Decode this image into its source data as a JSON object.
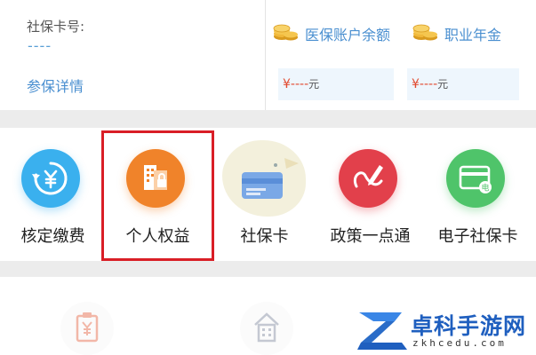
{
  "account": {
    "card_label": "社保卡号:",
    "card_number": "----",
    "detail_link": "参保详情"
  },
  "balances": [
    {
      "label": "医保账户余额",
      "amount": "¥----",
      "unit": "元",
      "icon": "gold-coins-icon"
    },
    {
      "label": "职业年金",
      "amount": "¥----",
      "unit": "元",
      "icon": "gold-coins-icon"
    }
  ],
  "services": [
    {
      "label": "核定缴费",
      "icon": "yen-cycle-icon",
      "color": "#3ab0ee"
    },
    {
      "label": "个人权益",
      "icon": "building-lock-icon",
      "color": "#f0832a"
    },
    {
      "label": "社保卡",
      "icon": "card-mascot-icon",
      "color": "#7aa8e6"
    },
    {
      "label": "政策一点通",
      "icon": "pen-swoosh-icon",
      "color": "#e2404b"
    },
    {
      "label": "电子社保卡",
      "icon": "e-card-icon",
      "color": "#4fc46a"
    }
  ],
  "bottom_icons": [
    {
      "icon": "yen-clipboard-icon"
    },
    {
      "icon": "building-icon"
    }
  ],
  "watermark": {
    "text": "卓科手游网",
    "url": "zkhcedu.com"
  },
  "colors": {
    "link_blue": "#4a8fd0",
    "amount_red": "#e2492e",
    "highlight_red": "#d91e26",
    "separator": "#ececec"
  }
}
